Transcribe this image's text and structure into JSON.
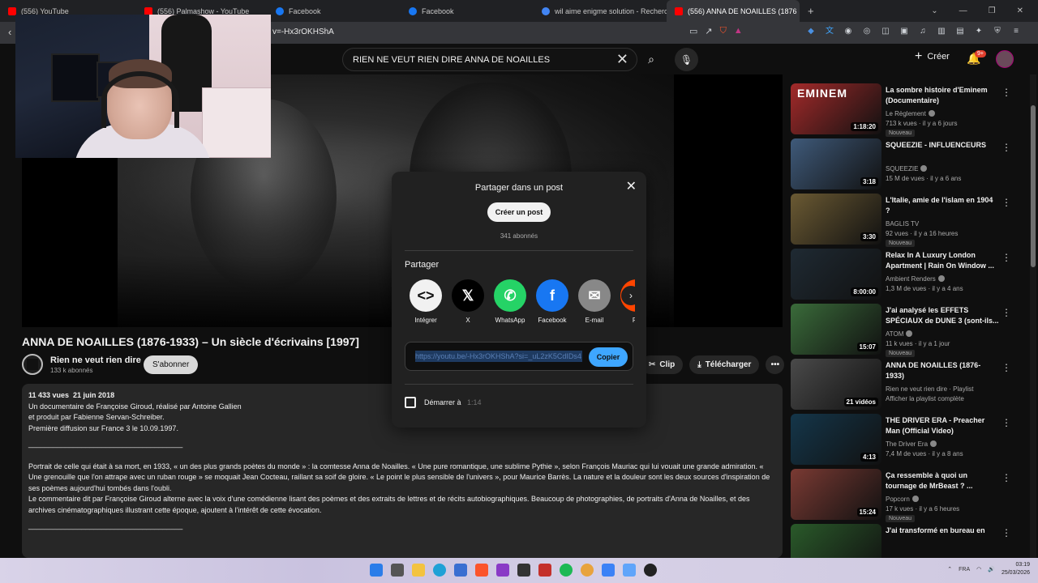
{
  "browser": {
    "tabs": [
      {
        "label": "(556) YouTube",
        "favicon_color": "#ff0000"
      },
      {
        "label": "(556) Palmashow - YouTube",
        "favicon_color": "#ff0000"
      },
      {
        "label": "Facebook",
        "favicon_color": "#1877f2"
      },
      {
        "label": "Facebook",
        "favicon_color": "#1877f2"
      },
      {
        "label": "wil aime enigme solution - Recherche",
        "favicon_color": "#4285f4"
      },
      {
        "label": "(556) ANNA DE NOAILLES (1876",
        "favicon_color": "#ff0000",
        "active": true
      }
    ],
    "url": "v=-Hx3rOKHShA"
  },
  "header": {
    "search_value": "RIEN NE VEUT RIEN DIRE  ANNA DE NOAILLES",
    "create_label": "Créer",
    "notif_badge": "9+"
  },
  "video": {
    "title": "ANNA DE NOAILLES (1876-1933) – Un siècle d'écrivains [1997]",
    "channel_name": "Rien ne veut rien dire",
    "channel_subs": "133 k abonnés",
    "subscribe_label": "S'abonner",
    "actions": {
      "clip": "Clip",
      "download": "Télécharger"
    }
  },
  "description": {
    "meta": "11 433 vues  21 juin 2018",
    "lines": [
      "Un documentaire de Françoise Giroud, réalisé par Antoine Gallien",
      "et produit par Fabienne Servan-Schreiber.",
      "Première diffusion sur France 3 le 10.09.1997."
    ],
    "separator": "______________________________________",
    "paragraph1": "Portrait de celle qui était à sa mort, en 1933, « un des plus grands poètes du monde » : la comtesse Anna de Noailles. « Une pure romantique, une sublime Pythie », selon François Mauriac qui lui vouait une grande admiration. « Une grenouille que l'on attrape avec un ruban rouge » se moquait Jean Cocteau, raillant sa soif de gloire. « Le point le plus sensible de l'univers », pour Maurice Barrès. La nature et la douleur sont les deux sources d'inspiration de ses poèmes aujourd'hui tombés dans l'oubli.",
    "paragraph2": "Le commentaire dit par Françoise Giroud alterne avec la voix d'une comédienne lisant des poèmes et des extraits de lettres et de récits autobiographiques. Beaucoup de photographies, de portraits d'Anna de Noailles, et des archives cinématographiques illustrant cette époque, ajoutent à l'intérêt de cette évocation.",
    "separator2": "______________________________________"
  },
  "share_modal": {
    "title": "Partager dans un post",
    "create_post": "Créer un post",
    "subscribers": "341 abonnés",
    "share_heading": "Partager",
    "targets": [
      {
        "label": "Intégrer",
        "glyph": "<>",
        "color": "#f1f1f1",
        "fg": "#0f0f0f"
      },
      {
        "label": "X",
        "glyph": "𝕏",
        "color": "#000000",
        "fg": "#ffffff"
      },
      {
        "label": "WhatsApp",
        "glyph": "✆",
        "color": "#25d366",
        "fg": "#ffffff"
      },
      {
        "label": "Facebook",
        "glyph": "f",
        "color": "#1877f2",
        "fg": "#ffffff"
      },
      {
        "label": "E-mail",
        "glyph": "✉",
        "color": "#888888",
        "fg": "#ffffff"
      },
      {
        "label": "Re",
        "glyph": "",
        "color": "#ff4500",
        "fg": "#ffffff"
      }
    ],
    "link": "https://youtu.be/-Hx3rOKHShA?si=_uL2zK5CdIDs4",
    "copy_label": "Copier",
    "start_label": "Démarrer à",
    "start_time": "1:14"
  },
  "sidebar": {
    "items": [
      {
        "title": "La sombre histoire d'Eminem (Documentaire)",
        "channel": "Le Règlement",
        "verified": true,
        "meta": "713 k vues · il y a 6 jours",
        "badge": "Nouveau",
        "duration": "1:18:20",
        "thumb": "#a32a2a",
        "thumb_text": "EMINEM"
      },
      {
        "title": "SQUEEZIE - INFLUENCEURS",
        "channel": "SQUEEZIE",
        "verified": true,
        "meta": "15 M de vues · il y a 6 ans",
        "badge": "",
        "duration": "3:18",
        "thumb": "#3f5a7a",
        "thumb_text": ""
      },
      {
        "title": "L'Italie, amie de l'islam en 1904 ?",
        "channel": "BAGLIS TV",
        "verified": false,
        "meta": "92 vues · il y a 16 heures",
        "badge": "Nouveau",
        "duration": "3:30",
        "thumb": "#6b5a33",
        "thumb_text": ""
      },
      {
        "title": "Relax In A Luxury London Apartment | Rain On Window ...",
        "channel": "Ambient Renders",
        "verified": true,
        "meta": "1,3 M de vues · il y a 4 ans",
        "badge": "",
        "duration": "8:00:00",
        "thumb": "#1f2a33",
        "thumb_text": ""
      },
      {
        "title": "J'ai analysé les EFFETS SPÉCIAUX de DUNE 3 (sont-ils...",
        "channel": "ATOM",
        "verified": true,
        "meta": "11 k vues · il y a 1 jour",
        "badge": "Nouveau",
        "duration": "15:07",
        "thumb": "#3a6b3a",
        "thumb_text": ""
      },
      {
        "title": "ANNA DE NOAILLES (1876-1933)",
        "channel": "Rien ne veut rien dire · Playlist",
        "verified": false,
        "meta": "Afficher la playlist complète",
        "badge": "",
        "duration": "21 vidéos",
        "thumb": "#4a4a4a",
        "thumb_text": ""
      },
      {
        "title": "THE DRIVER ERA - Preacher Man (Official Video)",
        "channel": "The Driver Era",
        "verified": true,
        "meta": "7,4 M de vues · il y a 8 ans",
        "badge": "",
        "duration": "4:13",
        "thumb": "#14364a",
        "thumb_text": ""
      },
      {
        "title": "Ça ressemble à quoi un tournage de MrBeast ? ...",
        "channel": "Popcorn",
        "verified": true,
        "meta": "17 k vues · il y a 6 heures",
        "badge": "Nouveau",
        "duration": "15:24",
        "thumb": "#7a3a33",
        "thumb_text": ""
      },
      {
        "title": "J'ai transformé en bureau en",
        "channel": "",
        "verified": false,
        "meta": "",
        "badge": "",
        "duration": "",
        "thumb": "#2a5a2a",
        "thumb_text": ""
      }
    ]
  },
  "taskbar": {
    "lang": "FRA",
    "time": "03:19",
    "date": "25/03/2026"
  }
}
